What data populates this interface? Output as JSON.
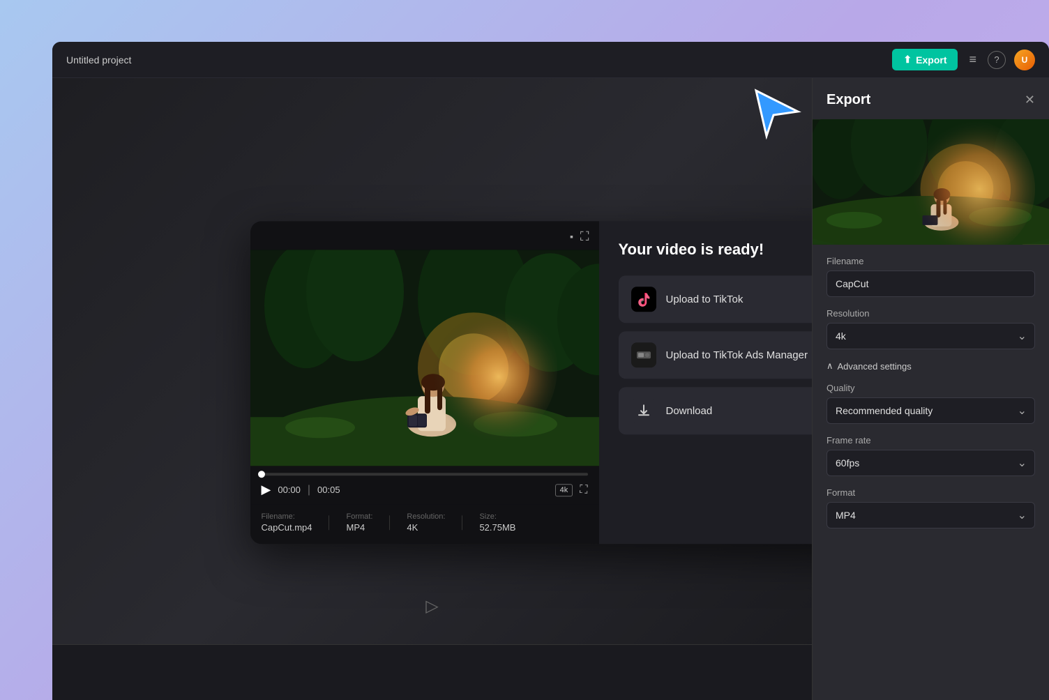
{
  "app": {
    "title": "Untitled project"
  },
  "topbar": {
    "export_label": "Export",
    "menu_icon": "≡",
    "help_icon": "?",
    "avatar_label": "U"
  },
  "export_panel": {
    "title": "Export",
    "close_icon": "✕",
    "filename_label": "Filename",
    "filename_value": "CapCut",
    "resolution_label": "Resolution",
    "resolution_value": "4k",
    "advanced_settings_label": "Advanced settings",
    "quality_label": "Quality",
    "quality_value": "Recommended quality",
    "framerate_label": "Frame rate",
    "framerate_value": "60fps",
    "format_label": "Format",
    "format_value": "MP4"
  },
  "video_ready_dialog": {
    "title": "Your video is ready!",
    "upload_tiktok_label": "Upload to TikTok",
    "upload_tiktok_ads_label": "Upload to TikTok Ads Manager",
    "download_label": "Download",
    "play_icon": "▶",
    "time_current": "00:00",
    "time_total": "00:05",
    "badge_4k": "4k",
    "fullscreen_icon": "⛶",
    "comment_icon": "💬",
    "expand_icon": "⛶",
    "metadata": {
      "filename_label": "Filename:",
      "filename_value": "CapCut.mp4",
      "format_label": "Format:",
      "format_value": "MP4",
      "resolution_label": "Resolution:",
      "resolution_value": "4K",
      "size_label": "Size:",
      "size_value": "52.75MB"
    }
  },
  "colors": {
    "export_btn_bg": "#00c4a0",
    "dialog_bg": "#1e1e24",
    "panel_bg": "#2a2a30",
    "action_btn_bg": "#2a2a32"
  }
}
